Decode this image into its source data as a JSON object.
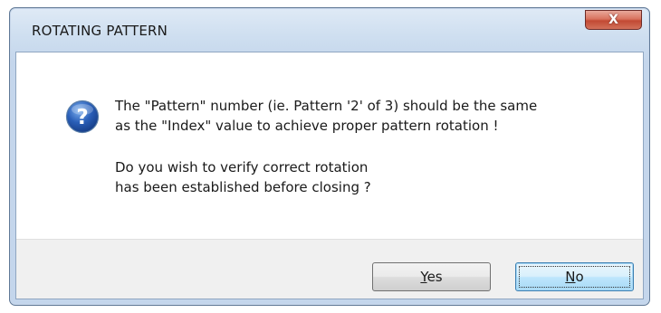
{
  "dialog": {
    "title": "ROTATING PATTERN",
    "close_label": "X",
    "icon": "question-icon",
    "message": {
      "line1": "The \"Pattern\" number (ie. Pattern '2' of 3) should be the same",
      "line2": "as the \"Index\" value to achieve proper pattern rotation !",
      "line3": "Do you wish to verify correct rotation",
      "line4": "has been established before closing ?"
    },
    "buttons": {
      "yes_accel": "Y",
      "yes_rest": "es",
      "no_accel": "N",
      "no_rest": "o"
    }
  },
  "colors": {
    "frame": "#cfdff0",
    "close_button": "#c24a33",
    "footer": "#f0f0f0",
    "icon_blue": "#2a5fb8"
  }
}
